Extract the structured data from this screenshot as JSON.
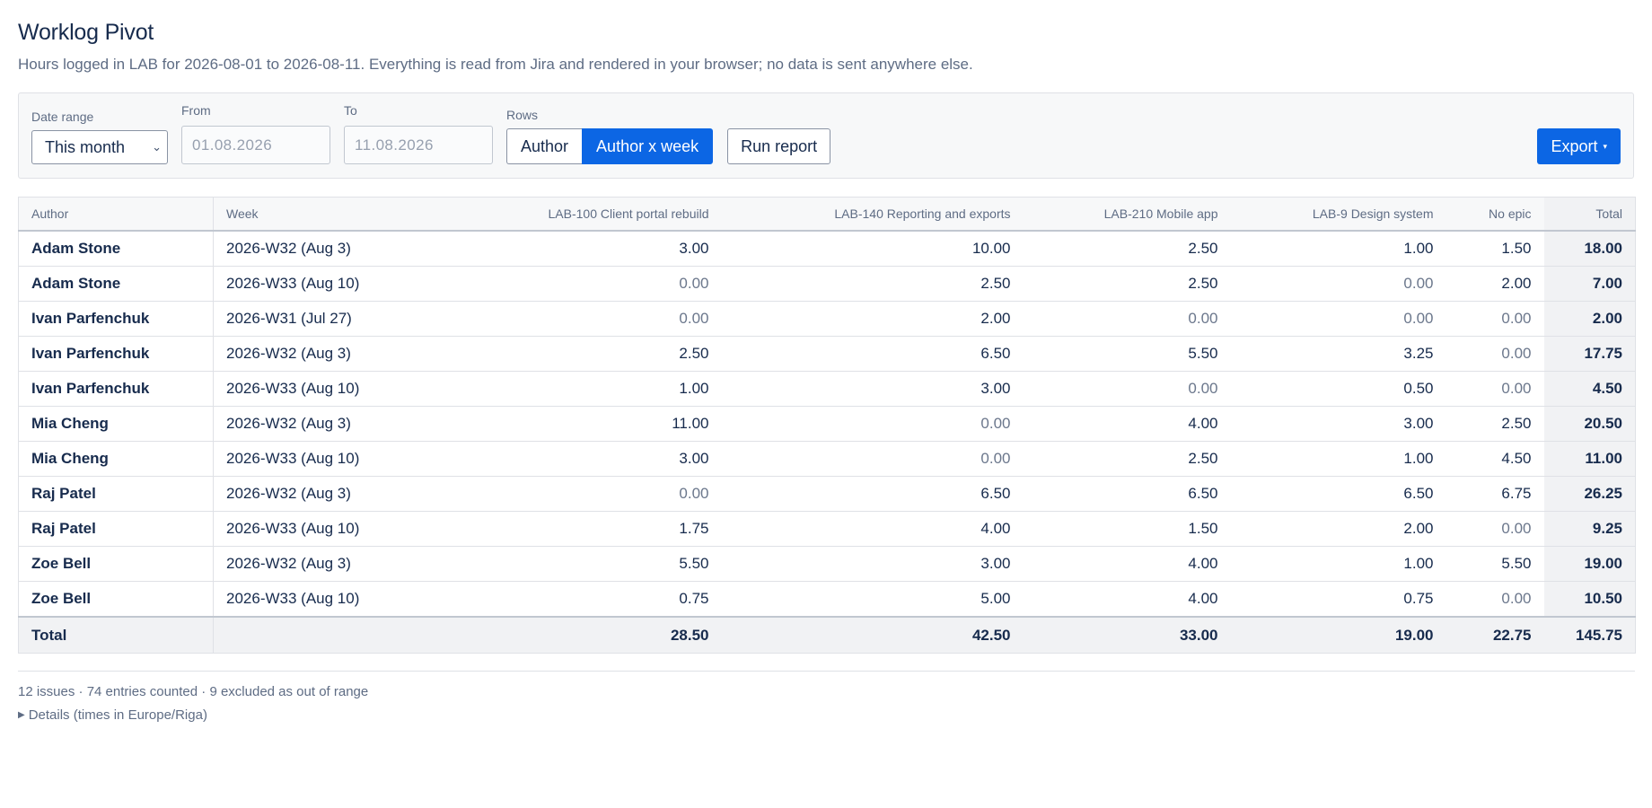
{
  "header": {
    "title": "Worklog Pivot",
    "subtitle": "Hours logged in LAB for 2026-08-01 to 2026-08-11. Everything is read from Jira and rendered in your browser; no data is sent anywhere else."
  },
  "toolbar": {
    "date_range_label": "Date range",
    "date_range_value": "This month",
    "from_label": "From",
    "from_value": "01.08.2026",
    "to_label": "To",
    "to_value": "11.08.2026",
    "rows_label": "Rows",
    "rows_options": [
      "Author",
      "Author x week"
    ],
    "rows_selected": "Author x week",
    "run_label": "Run report",
    "export_label": "Export",
    "accent_color": "#0c66e4"
  },
  "table": {
    "columns": [
      "Author",
      "Week",
      "LAB-100 Client portal rebuild",
      "LAB-140 Reporting and exports",
      "LAB-210 Mobile app",
      "LAB-9 Design system",
      "No epic",
      "Total"
    ],
    "rows": [
      [
        "Adam Stone",
        "2026-W32 (Aug 3)",
        "3.00",
        "10.00",
        "2.50",
        "1.00",
        "1.50",
        "18.00"
      ],
      [
        "Adam Stone",
        "2026-W33 (Aug 10)",
        "0.00",
        "2.50",
        "2.50",
        "0.00",
        "2.00",
        "7.00"
      ],
      [
        "Ivan Parfenchuk",
        "2026-W31 (Jul 27)",
        "0.00",
        "2.00",
        "0.00",
        "0.00",
        "0.00",
        "2.00"
      ],
      [
        "Ivan Parfenchuk",
        "2026-W32 (Aug 3)",
        "2.50",
        "6.50",
        "5.50",
        "3.25",
        "0.00",
        "17.75"
      ],
      [
        "Ivan Parfenchuk",
        "2026-W33 (Aug 10)",
        "1.00",
        "3.00",
        "0.00",
        "0.50",
        "0.00",
        "4.50"
      ],
      [
        "Mia Cheng",
        "2026-W32 (Aug 3)",
        "11.00",
        "0.00",
        "4.00",
        "3.00",
        "2.50",
        "20.50"
      ],
      [
        "Mia Cheng",
        "2026-W33 (Aug 10)",
        "3.00",
        "0.00",
        "2.50",
        "1.00",
        "4.50",
        "11.00"
      ],
      [
        "Raj Patel",
        "2026-W32 (Aug 3)",
        "0.00",
        "6.50",
        "6.50",
        "6.50",
        "6.75",
        "26.25"
      ],
      [
        "Raj Patel",
        "2026-W33 (Aug 10)",
        "1.75",
        "4.00",
        "1.50",
        "2.00",
        "0.00",
        "9.25"
      ],
      [
        "Zoe Bell",
        "2026-W32 (Aug 3)",
        "5.50",
        "3.00",
        "4.00",
        "1.00",
        "5.50",
        "19.00"
      ],
      [
        "Zoe Bell",
        "2026-W33 (Aug 10)",
        "0.75",
        "5.00",
        "4.00",
        "0.75",
        "0.00",
        "10.50"
      ]
    ],
    "totals": [
      "Total",
      "",
      "28.50",
      "42.50",
      "33.00",
      "19.00",
      "22.75",
      "145.75"
    ]
  },
  "footer": {
    "summary": "12 issues · 74 entries counted · 9 excluded as out of range",
    "details_label": "Details (times in Europe/Riga)"
  }
}
